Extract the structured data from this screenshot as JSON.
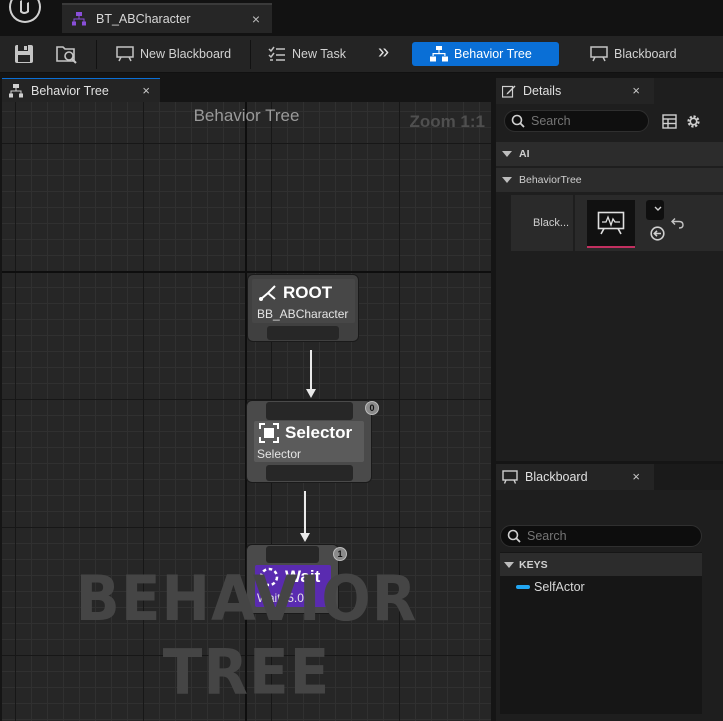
{
  "asset_tab": {
    "title": "BT_ABCharacter",
    "close": "×"
  },
  "toolbar": {
    "new_blackboard": "New Blackboard",
    "new_task": "New Task",
    "behavior_tree": "Behavior Tree",
    "blackboard": "Blackboard",
    "overflow": "»"
  },
  "graph_tab": {
    "label": "Behavior Tree",
    "close": "×"
  },
  "graph": {
    "title": "Behavior Tree",
    "zoom": "Zoom 1:1",
    "watermark": "BEHAVIOR TREE",
    "nodes": {
      "root": {
        "title": "ROOT",
        "subtitle": "BB_ABCharacter"
      },
      "selector": {
        "title": "Selector",
        "subtitle": "Selector",
        "index": "0"
      },
      "wait": {
        "title": "Wait",
        "subtitle": "Wait: 5.0s",
        "index": "1",
        "color": "#5a2bb0"
      }
    }
  },
  "details": {
    "tab_label": "Details",
    "close": "×",
    "search_placeholder": "Search",
    "categories": {
      "ai": "AI",
      "behavior_tree": "BehaviorTree"
    },
    "property_label": "Black..."
  },
  "blackboard": {
    "tab_label": "Blackboard",
    "close": "×",
    "search_placeholder": "Search",
    "keys_header": "KEYS",
    "keys": [
      {
        "name": "SelfActor",
        "color": "#22a6f2"
      }
    ]
  },
  "colors": {
    "accent": "#0a6fd6",
    "wait_node": "#5a2bb0",
    "key_object": "#22a6f2"
  }
}
